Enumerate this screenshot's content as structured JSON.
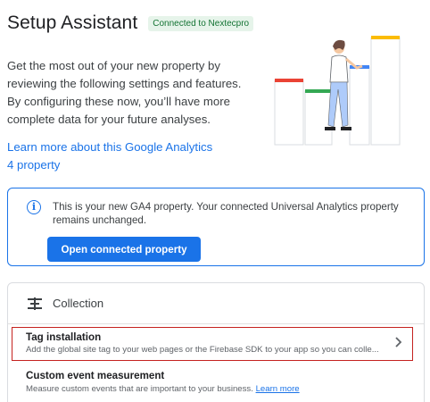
{
  "header": {
    "title": "Setup Assistant",
    "badge": "Connected to Nextecpro"
  },
  "intro": {
    "text": "Get the most out of your new property by reviewing the following settings and features. By configuring these now, you’ll have more complete data for your future analyses.",
    "link": "Learn more about this Google Analytics 4 property"
  },
  "info_card": {
    "icon": "info-icon",
    "message": "This is your new GA4 property. Your connected Universal Analytics property remains unchanged.",
    "button_label": "Open connected property"
  },
  "collection": {
    "icon": "collection-icon",
    "title": "Collection",
    "items": [
      {
        "title": "Tag installation",
        "description": "Add the global site tag to your web pages or the Firebase SDK to your app so you can colle...",
        "icon": "chevron-right-icon"
      },
      {
        "title": "Custom event measurement",
        "description": "Measure custom events that are important to your business.",
        "link": "Learn more"
      }
    ]
  },
  "colors": {
    "accent": "#1a73e8",
    "badge_bg": "#e6f4ea",
    "badge_text": "#137333",
    "highlight": "#c5221f",
    "bar_red": "#ea4335",
    "bar_green": "#34a853",
    "bar_blue": "#4285f4",
    "bar_yellow": "#fbbc04"
  }
}
